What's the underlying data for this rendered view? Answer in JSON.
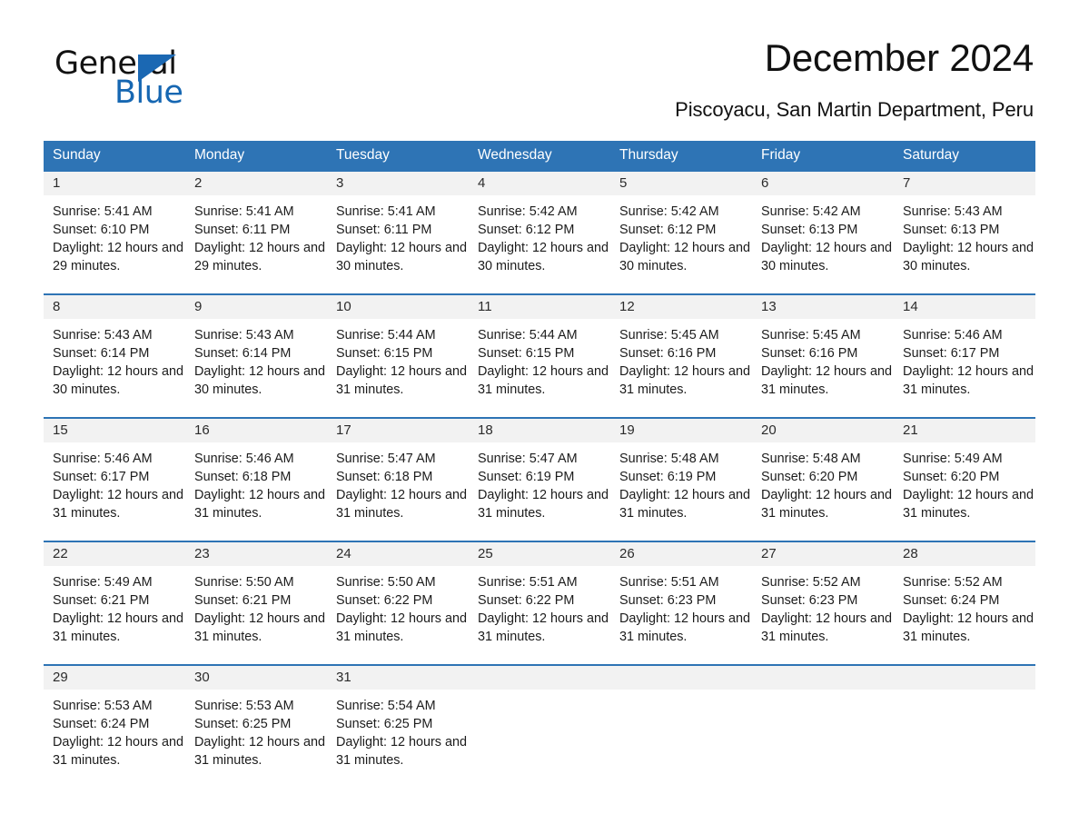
{
  "brand": {
    "word_general": "General",
    "word_blue": "Blue",
    "logo_icon": "general-blue-triangle-icon"
  },
  "header": {
    "title": "December 2024",
    "subtitle": "Piscoyacu, San Martin Department, Peru"
  },
  "colors": {
    "header_blue": "#2e74b5",
    "daynum_gray": "#f2f2f2",
    "brand_blue": "#1667b2",
    "text": "#1a1a1a"
  },
  "weekdays": [
    "Sunday",
    "Monday",
    "Tuesday",
    "Wednesday",
    "Thursday",
    "Friday",
    "Saturday"
  ],
  "weeks": [
    [
      {
        "day": "1",
        "info": "Sunrise: 5:41 AM\nSunset: 6:10 PM\nDaylight: 12 hours and 29 minutes."
      },
      {
        "day": "2",
        "info": "Sunrise: 5:41 AM\nSunset: 6:11 PM\nDaylight: 12 hours and 29 minutes."
      },
      {
        "day": "3",
        "info": "Sunrise: 5:41 AM\nSunset: 6:11 PM\nDaylight: 12 hours and 30 minutes."
      },
      {
        "day": "4",
        "info": "Sunrise: 5:42 AM\nSunset: 6:12 PM\nDaylight: 12 hours and 30 minutes."
      },
      {
        "day": "5",
        "info": "Sunrise: 5:42 AM\nSunset: 6:12 PM\nDaylight: 12 hours and 30 minutes."
      },
      {
        "day": "6",
        "info": "Sunrise: 5:42 AM\nSunset: 6:13 PM\nDaylight: 12 hours and 30 minutes."
      },
      {
        "day": "7",
        "info": "Sunrise: 5:43 AM\nSunset: 6:13 PM\nDaylight: 12 hours and 30 minutes."
      }
    ],
    [
      {
        "day": "8",
        "info": "Sunrise: 5:43 AM\nSunset: 6:14 PM\nDaylight: 12 hours and 30 minutes."
      },
      {
        "day": "9",
        "info": "Sunrise: 5:43 AM\nSunset: 6:14 PM\nDaylight: 12 hours and 30 minutes."
      },
      {
        "day": "10",
        "info": "Sunrise: 5:44 AM\nSunset: 6:15 PM\nDaylight: 12 hours and 31 minutes."
      },
      {
        "day": "11",
        "info": "Sunrise: 5:44 AM\nSunset: 6:15 PM\nDaylight: 12 hours and 31 minutes."
      },
      {
        "day": "12",
        "info": "Sunrise: 5:45 AM\nSunset: 6:16 PM\nDaylight: 12 hours and 31 minutes."
      },
      {
        "day": "13",
        "info": "Sunrise: 5:45 AM\nSunset: 6:16 PM\nDaylight: 12 hours and 31 minutes."
      },
      {
        "day": "14",
        "info": "Sunrise: 5:46 AM\nSunset: 6:17 PM\nDaylight: 12 hours and 31 minutes."
      }
    ],
    [
      {
        "day": "15",
        "info": "Sunrise: 5:46 AM\nSunset: 6:17 PM\nDaylight: 12 hours and 31 minutes."
      },
      {
        "day": "16",
        "info": "Sunrise: 5:46 AM\nSunset: 6:18 PM\nDaylight: 12 hours and 31 minutes."
      },
      {
        "day": "17",
        "info": "Sunrise: 5:47 AM\nSunset: 6:18 PM\nDaylight: 12 hours and 31 minutes."
      },
      {
        "day": "18",
        "info": "Sunrise: 5:47 AM\nSunset: 6:19 PM\nDaylight: 12 hours and 31 minutes."
      },
      {
        "day": "19",
        "info": "Sunrise: 5:48 AM\nSunset: 6:19 PM\nDaylight: 12 hours and 31 minutes."
      },
      {
        "day": "20",
        "info": "Sunrise: 5:48 AM\nSunset: 6:20 PM\nDaylight: 12 hours and 31 minutes."
      },
      {
        "day": "21",
        "info": "Sunrise: 5:49 AM\nSunset: 6:20 PM\nDaylight: 12 hours and 31 minutes."
      }
    ],
    [
      {
        "day": "22",
        "info": "Sunrise: 5:49 AM\nSunset: 6:21 PM\nDaylight: 12 hours and 31 minutes."
      },
      {
        "day": "23",
        "info": "Sunrise: 5:50 AM\nSunset: 6:21 PM\nDaylight: 12 hours and 31 minutes."
      },
      {
        "day": "24",
        "info": "Sunrise: 5:50 AM\nSunset: 6:22 PM\nDaylight: 12 hours and 31 minutes."
      },
      {
        "day": "25",
        "info": "Sunrise: 5:51 AM\nSunset: 6:22 PM\nDaylight: 12 hours and 31 minutes."
      },
      {
        "day": "26",
        "info": "Sunrise: 5:51 AM\nSunset: 6:23 PM\nDaylight: 12 hours and 31 minutes."
      },
      {
        "day": "27",
        "info": "Sunrise: 5:52 AM\nSunset: 6:23 PM\nDaylight: 12 hours and 31 minutes."
      },
      {
        "day": "28",
        "info": "Sunrise: 5:52 AM\nSunset: 6:24 PM\nDaylight: 12 hours and 31 minutes."
      }
    ],
    [
      {
        "day": "29",
        "info": "Sunrise: 5:53 AM\nSunset: 6:24 PM\nDaylight: 12 hours and 31 minutes."
      },
      {
        "day": "30",
        "info": "Sunrise: 5:53 AM\nSunset: 6:25 PM\nDaylight: 12 hours and 31 minutes."
      },
      {
        "day": "31",
        "info": "Sunrise: 5:54 AM\nSunset: 6:25 PM\nDaylight: 12 hours and 31 minutes."
      },
      {
        "day": "",
        "info": ""
      },
      {
        "day": "",
        "info": ""
      },
      {
        "day": "",
        "info": ""
      },
      {
        "day": "",
        "info": ""
      }
    ]
  ]
}
